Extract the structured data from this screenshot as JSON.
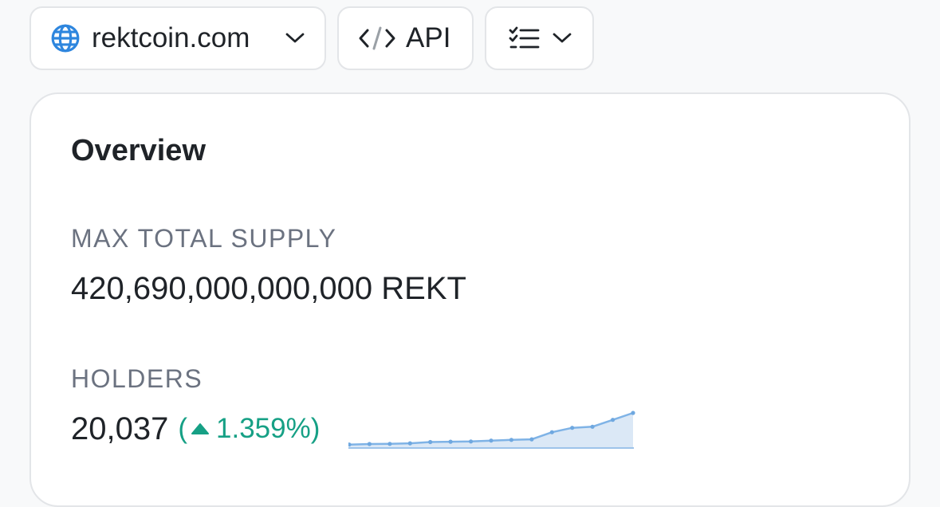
{
  "toolbar": {
    "site": {
      "label": "rektcoin.com",
      "icon": "globe-icon",
      "chevron": "chevron-down-icon"
    },
    "api": {
      "label": "API",
      "icon": "code-icon"
    },
    "view": {
      "icon": "checklist-icon",
      "chevron": "chevron-down-icon"
    }
  },
  "overview": {
    "title": "Overview",
    "max_total_supply": {
      "label": "MAX TOTAL SUPPLY",
      "value": "420,690,000,000,000 REKT"
    },
    "holders": {
      "label": "HOLDERS",
      "value": "20,037",
      "change_open": "(",
      "change_value": "1.359%)",
      "change_direction": "up",
      "change_color": "#16a085",
      "sparkline_values": [
        1.0,
        1.3,
        1.4,
        1.7,
        2.4,
        2.6,
        2.7,
        3.2,
        3.6,
        3.9,
        7.8,
        10.2,
        10.8,
        14.6,
        18.4
      ]
    }
  },
  "colors": {
    "accent": "#2e86de",
    "sparkline_line": "#7fb3e6",
    "sparkline_fill": "#dbe8f6",
    "muted_text": "#6b7280",
    "border": "#e3e5e8"
  }
}
